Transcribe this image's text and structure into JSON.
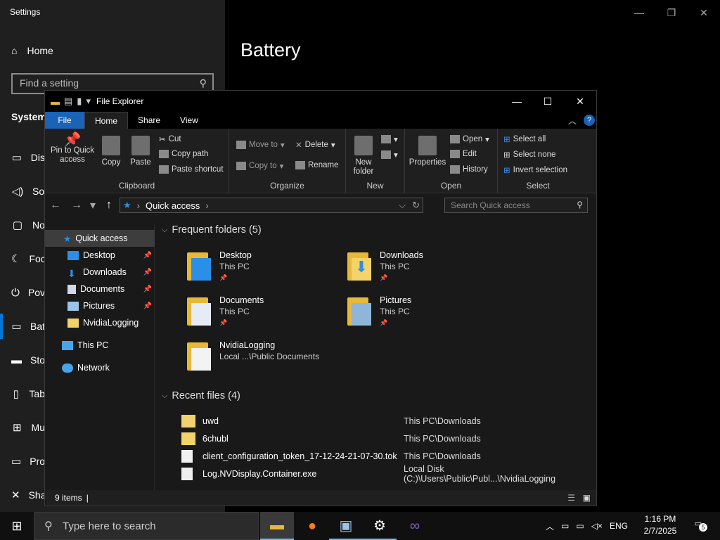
{
  "settings": {
    "title": "Settings",
    "home": "Home",
    "search_placeholder": "Find a setting",
    "section": "System",
    "nav": [
      "Dis",
      "So",
      "No",
      "Foc",
      "Pov",
      "Bat",
      "Sto",
      "Tab",
      "Mu",
      "Pro",
      "Sha"
    ],
    "page_title": "Battery"
  },
  "explorer": {
    "title": "File Explorer",
    "tabs": [
      "File",
      "Home",
      "Share",
      "View"
    ],
    "ribbon": {
      "clipboard": {
        "label": "Clipboard",
        "pin": "Pin to Quick access",
        "copy": "Copy",
        "paste": "Paste",
        "cut": "Cut",
        "copy_path": "Copy path",
        "paste_shortcut": "Paste shortcut"
      },
      "organize": {
        "label": "Organize",
        "move_to": "Move to",
        "copy_to": "Copy to",
        "delete": "Delete",
        "rename": "Rename"
      },
      "new": {
        "label": "New",
        "new_folder": "New folder"
      },
      "open": {
        "label": "Open",
        "properties": "Properties",
        "open": "Open",
        "edit": "Edit",
        "history": "History"
      },
      "select": {
        "label": "Select",
        "select_all": "Select all",
        "select_none": "Select none",
        "invert": "Invert selection"
      }
    },
    "address": "Quick access",
    "search_placeholder": "Search Quick access",
    "nav_pane": {
      "quick_access": "Quick access",
      "items": [
        "Desktop",
        "Downloads",
        "Documents",
        "Pictures",
        "NvidiaLogging"
      ],
      "this_pc": "This PC",
      "network": "Network"
    },
    "frequent_header": "Frequent folders (5)",
    "frequent": [
      {
        "name": "Desktop",
        "location": "This PC"
      },
      {
        "name": "Downloads",
        "location": "This PC"
      },
      {
        "name": "Documents",
        "location": "This PC"
      },
      {
        "name": "Pictures",
        "location": "This PC"
      },
      {
        "name": "NvidiaLogging",
        "location": "Local ...\\Public Documents"
      }
    ],
    "recent_header": "Recent files (4)",
    "recent": [
      {
        "name": "uwd",
        "location": "This PC\\Downloads"
      },
      {
        "name": "6chubl",
        "location": "This PC\\Downloads"
      },
      {
        "name": "client_configuration_token_17-12-24-21-07-30.tok",
        "location": "This PC\\Downloads"
      },
      {
        "name": "Log.NVDisplay.Container.exe",
        "location": "Local Disk (C:)\\Users\\Public\\Publ...\\NvidiaLogging"
      }
    ],
    "status": "9 items"
  },
  "taskbar": {
    "search_placeholder": "Type here to search",
    "language": "ENG",
    "time": "1:16 PM",
    "date": "2/7/2025",
    "notifications": "5"
  }
}
